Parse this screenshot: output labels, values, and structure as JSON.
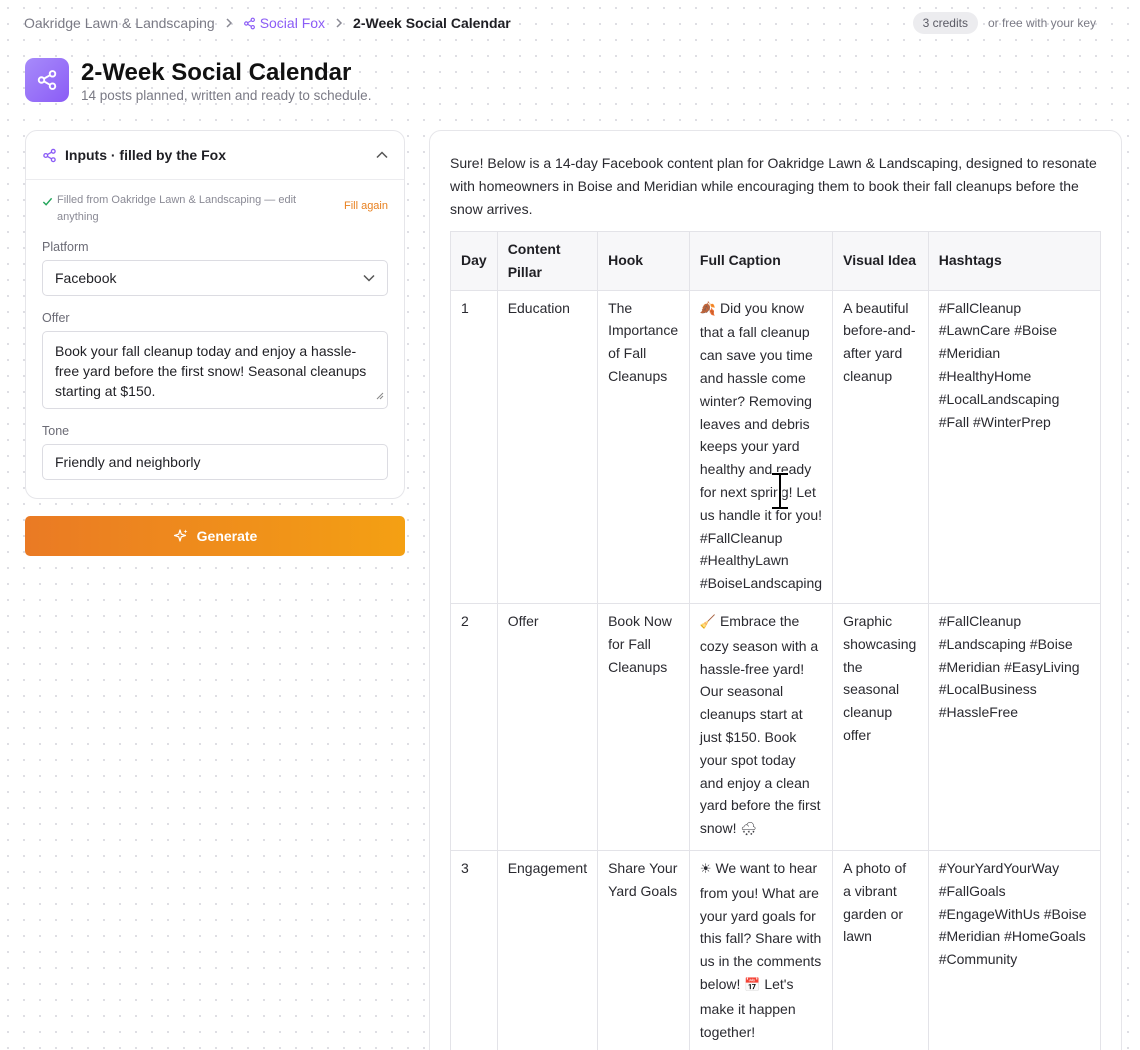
{
  "breadcrumb": {
    "home": "Oakridge Lawn & Landscaping",
    "app": "Social Fox",
    "current": "2-Week Social Calendar"
  },
  "credits": {
    "badge": "3 credits",
    "note": "or free with your key"
  },
  "header": {
    "title": "2-Week Social Calendar",
    "subtitle": "14 posts planned, written and ready to schedule."
  },
  "inputs": {
    "title": "Inputs · filled by the Fox",
    "filled_note": "Filled from Oakridge Lawn & Landscaping — edit anything",
    "fill_again": "Fill again",
    "platform_label": "Platform",
    "platform_value": "Facebook",
    "offer_label": "Offer",
    "offer_value": "Book your fall cleanup today and enjoy a hassle-free yard before the first snow! Seasonal cleanups starting at $150.",
    "tone_label": "Tone",
    "tone_value": "Friendly and neighborly"
  },
  "generate_label": "Generate",
  "output": {
    "intro": "Sure! Below is a 14-day Facebook content plan for Oakridge Lawn & Landscaping, designed to resonate with homeowners in Boise and Meridian while encouraging them to book their fall cleanups before the snow arrives.",
    "columns": [
      "Day",
      "Content Pillar",
      "Hook",
      "Full Caption",
      "Visual Idea",
      "Hashtags"
    ],
    "rows": [
      {
        "day": "1",
        "pillar": "Education",
        "hook": "The Importance of Fall Cleanups",
        "caption_emoji": "🍂",
        "caption": "Did you know that a fall cleanup can save you time and hassle come winter? Removing leaves and debris keeps your yard healthy and ready for next spring! Let us handle it for you! #FallCleanup #HealthyLawn #BoiseLandscaping",
        "visual": "A beautiful before-and-after yard cleanup",
        "hashtags": "#FallCleanup #LawnCare #Boise #Meridian #HealthyHome #LocalLandscaping #Fall #WinterPrep"
      },
      {
        "day": "2",
        "pillar": "Offer",
        "hook": "Book Now for Fall Cleanups",
        "caption_emoji": "🧹",
        "caption": "Embrace the cozy season with a hassle-free yard! Our seasonal cleanups start at just $150. Book your spot today and enjoy a clean yard before the first snow!",
        "caption_end_emoji": "🌨",
        "visual": "Graphic showcasing the seasonal cleanup offer",
        "hashtags": "#FallCleanup #Landscaping #Boise #Meridian #EasyLiving #LocalBusiness #HassleFree"
      },
      {
        "day": "3",
        "pillar": "Engagement",
        "hook": "Share Your Yard Goals",
        "caption_emoji": "☀",
        "caption": "We want to hear from you! What are your yard goals for this fall? Share with us in the comments below!",
        "caption_mid_emoji": "📅",
        "caption_tail": "Let's make it happen together!",
        "visual": "A photo of a vibrant garden or lawn",
        "hashtags": "#YourYardYourWay #FallGoals #EngageWithUs #Boise #Meridian #HomeGoals #Community"
      }
    ]
  }
}
